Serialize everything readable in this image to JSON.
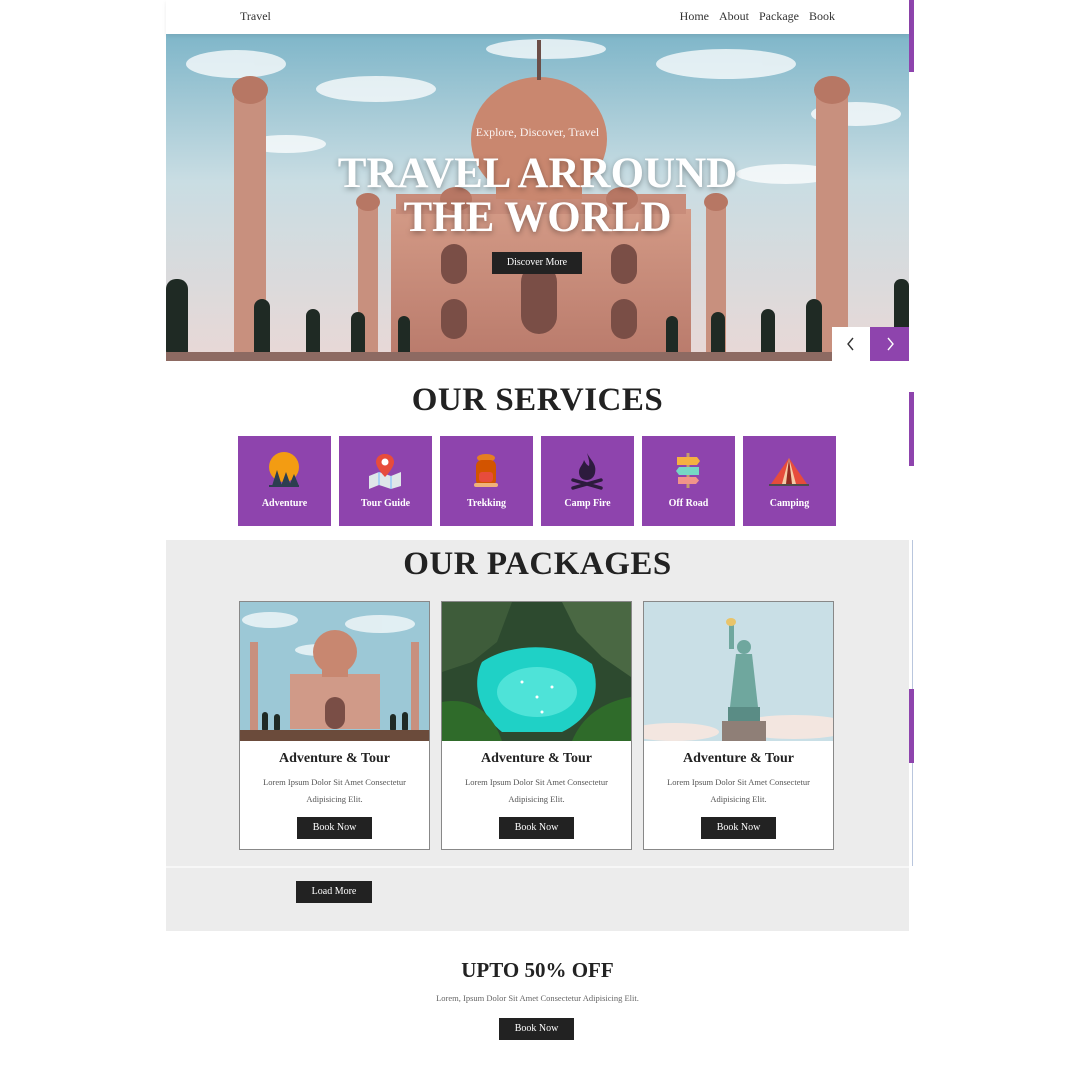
{
  "navbar": {
    "brand": "Travel",
    "links": [
      "Home",
      "About",
      "Package",
      "Book"
    ]
  },
  "hero": {
    "subtitle": "Explore, Discover, Travel",
    "title": "TRAVEL ARROUND THE WORLD",
    "button": "Discover More",
    "prev_icon": "chevron-left-icon",
    "next_icon": "chevron-right-icon"
  },
  "services": {
    "title": "OUR SERVICES",
    "items": [
      {
        "label": "Adventure",
        "icon": "sunset-trees-icon"
      },
      {
        "label": "Tour Guide",
        "icon": "map-pin-icon"
      },
      {
        "label": "Trekking",
        "icon": "backpack-icon"
      },
      {
        "label": "Camp Fire",
        "icon": "campfire-icon"
      },
      {
        "label": "Off Road",
        "icon": "signpost-icon"
      },
      {
        "label": "Camping",
        "icon": "tent-icon"
      }
    ]
  },
  "packages": {
    "title": "OUR PACKAGES",
    "items": [
      {
        "title": "Adventure & Tour",
        "text": "Lorem Ipsum Dolor Sit Amet Consectetur Adipisicing Elit.",
        "button": "Book Now",
        "image": "taj-mahal"
      },
      {
        "title": "Adventure & Tour",
        "text": "Lorem Ipsum Dolor Sit Amet Consectetur Adipisicing Elit.",
        "button": "Book Now",
        "image": "tropical-bay"
      },
      {
        "title": "Adventure & Tour",
        "text": "Lorem Ipsum Dolor Sit Amet Consectetur Adipisicing Elit.",
        "button": "Book Now",
        "image": "statue-of-liberty"
      }
    ],
    "load_more": "Load More"
  },
  "offer": {
    "title": "UPTO 50% OFF",
    "text": "Lorem, Ipsum Dolor Sit Amet Consectetur Adipisicing Elit.",
    "button": "Book Now"
  },
  "colors": {
    "accent": "#8e44ad",
    "dark_button": "#222222",
    "packages_bg": "#ececec"
  }
}
